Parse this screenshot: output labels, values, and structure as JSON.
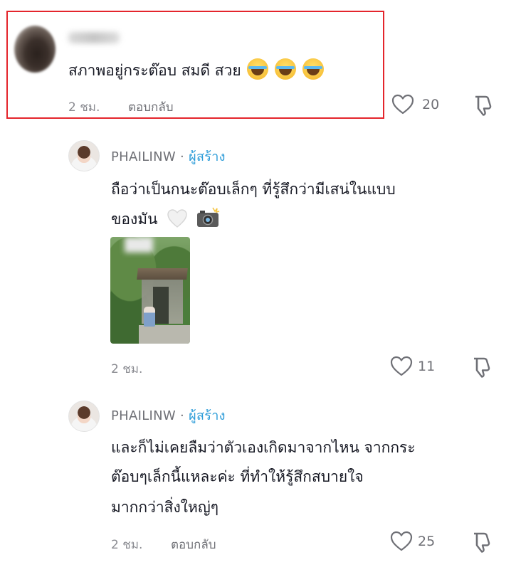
{
  "comments": [
    {
      "text": "สภาพอยู่กระต๊อบ สมดี สวย",
      "emoji": [
        "face-with-tears-of-joy",
        "face-with-tears-of-joy",
        "face-with-tears-of-joy"
      ],
      "time": "2 ชม.",
      "reply_label": "ตอบกลับ",
      "likes": "20"
    },
    {
      "username": "PHAILINW",
      "separator": " · ",
      "creator_label": "ผู้สร้าง",
      "text_line1": " ถือว่าเป็นกนะต๊อบเล็กๆ ที่รู้สึกว่ามีเสน่ในแบบ",
      "text_line2": "ของมัน",
      "emoji": [
        "white-heart",
        "camera-with-flash"
      ],
      "time": "2 ชม.",
      "likes": "11"
    },
    {
      "username": "PHAILINW",
      "separator": " · ",
      "creator_label": "ผู้สร้าง",
      "text_line1": "และก็ไม่เคยลืมว่าตัวเองเกิดมาจากไหน จากกระ",
      "text_line2": "ต๊อบๆเล็กนี้แหละค่ะ ที่ทำให้รู้สึกสบายใจ",
      "text_line3": "มากกว่าสิ่งใหญ่ๆ",
      "time": "2 ชม.",
      "reply_label": "ตอบกลับ",
      "likes": "25"
    }
  ],
  "colors": {
    "highlight": "#e4252c",
    "creator_tag": "#2a9bd8",
    "meta_text": "#8a8b91"
  }
}
